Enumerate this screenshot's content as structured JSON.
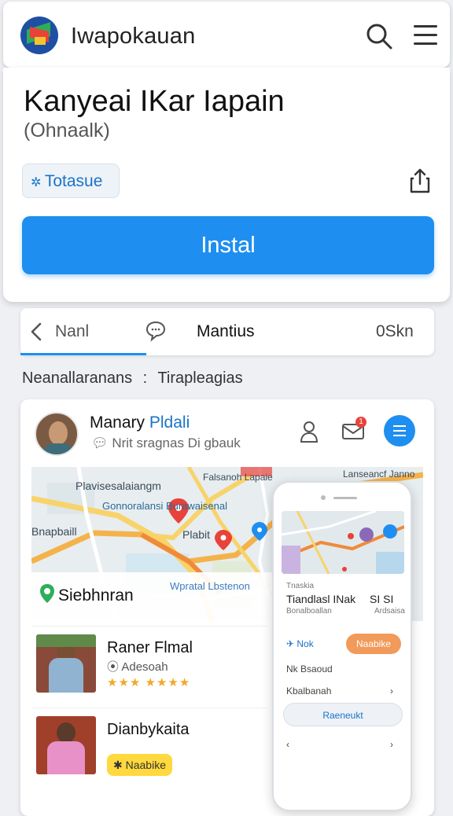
{
  "topbar": {
    "app_name": "Iwapokauan"
  },
  "hero": {
    "title": "Kanyeai IKar Iapain",
    "subtitle": "(Ohnaalk)",
    "chip_label": "Totasue",
    "install_label": "Instal"
  },
  "tabs": {
    "near_label": "Nanl",
    "mention_label": "Mantius",
    "stat_label": "0Skn"
  },
  "crumb": {
    "left": "Neanallaranans",
    "sep": ":",
    "right": "Tirapleagias"
  },
  "card": {
    "user_name_a": "Manary",
    "user_name_b": "Pldali",
    "user_sub": "Nrit sragnas Di gbauk",
    "msg_badge": "1",
    "map_labels": [
      "Plavisesalaiangm",
      "Gonnoralansi Burawaisenal",
      "Bnapbaill",
      "Plabit",
      "Falsanoh Lapaie",
      "Lanseancf Janno"
    ],
    "location_name": "Siebhnran",
    "location_hint": "Wpratal Lbstenon",
    "people": [
      {
        "name": "Raner Flmal",
        "sub": "Adesoah",
        "rating_text": "★★★ ★★★★"
      },
      {
        "name": "Dianbykaita",
        "badge": "Naabike"
      }
    ]
  },
  "phone": {
    "small_a": "Tnaskia",
    "title": "Tiandlasl INak",
    "title_num": "SI SI",
    "sub": "Bonalboallan",
    "sub2": "Ardsaisa",
    "link": "Nok",
    "orange": "Naabike",
    "row1": "Nk Bsaoud",
    "row2": "Kbalbanah",
    "btn": "Raeneukt"
  },
  "colors": {
    "accent": "#1e8ff0",
    "badge": "#ffd93d",
    "orange": "#f19a59"
  }
}
